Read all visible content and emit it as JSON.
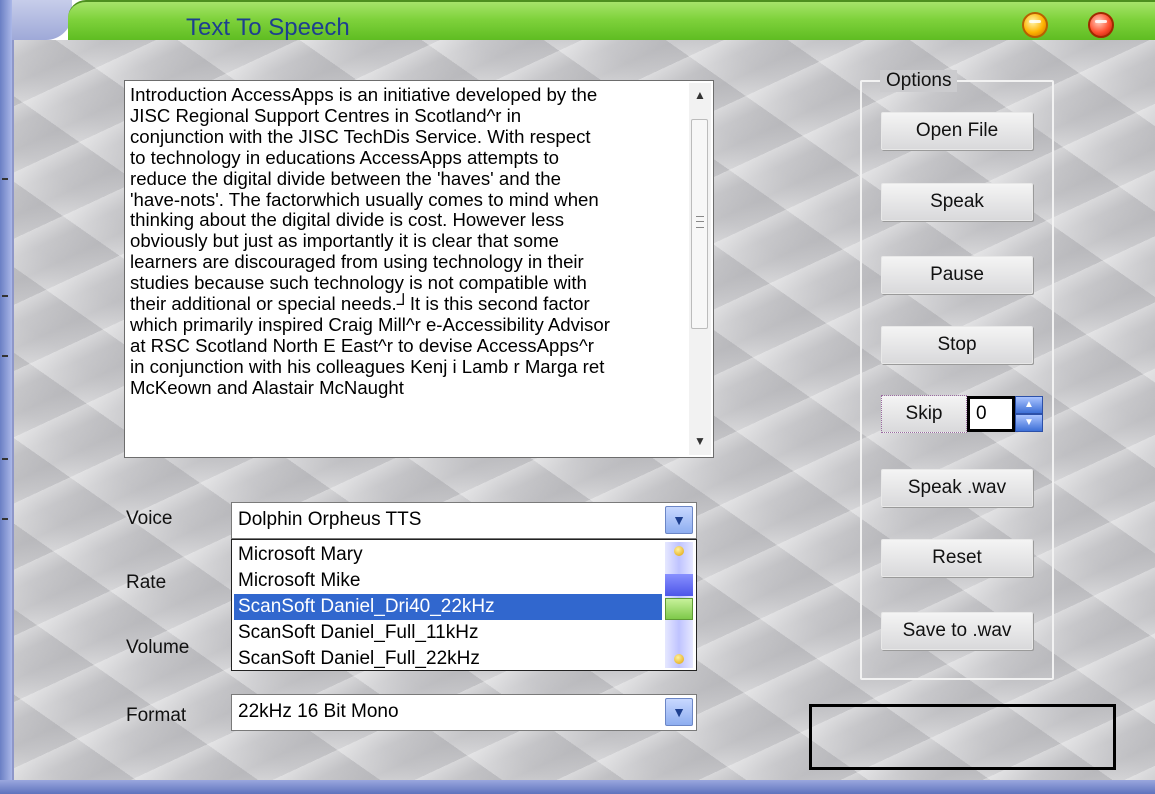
{
  "window": {
    "title": "Text To Speech"
  },
  "text_area": {
    "lines": [
      "Introduction AccessApps is an initiative developed by the",
      "JISC Regional Support Centres in Scotland^r in",
      "conjunction with the JISC TechDis Service. With respect",
      "to technology in educations AccessApps attempts to",
      "reduce the digital divide between the 'haves' and the",
      "'have-nots'. The factorwhich usually comes to mind when",
      "thinking about the digital divide is cost. However less",
      "obviously but just as importantly it is clear that some",
      "learners are discouraged from using technology in their",
      "studies because such technology is not compatible with",
      "their additional or special needs.┘It is this second factor",
      "which primarily inspired Craig Mill^r e-Accessibility Advisor",
      "at RSC Scotland North E East^r to devise AccessApps^r",
      "in conjunction with his colleagues Kenj i Lamb r Marga ret",
      "McKeown and Alastair McNaught"
    ]
  },
  "labels": {
    "voice": "Voice",
    "rate": "Rate",
    "volume": "Volume",
    "format": "Format"
  },
  "voice_combo": {
    "value": "Dolphin Orpheus TTS",
    "options": [
      "Microsoft Mary",
      "Microsoft Mike",
      "ScanSoft Daniel_Dri40_22kHz",
      "ScanSoft Daniel_Full_11kHz",
      "ScanSoft Daniel_Full_22kHz"
    ],
    "selected_index": 2
  },
  "format_combo": {
    "value": "22kHz 16 Bit Mono"
  },
  "options": {
    "legend": "Options",
    "open_file": "Open File",
    "speak": "Speak",
    "pause": "Pause",
    "stop": "Stop",
    "skip": "Skip",
    "skip_value": "0",
    "speak_wav": "Speak .wav",
    "reset": "Reset",
    "save_wav": "Save to .wav"
  },
  "icons": {
    "minimize": "minimize-orb-icon",
    "close": "close-orb-icon",
    "dropdown": "chevron-down-icon",
    "spin_up": "triangle-up-icon",
    "spin_down": "triangle-down-icon"
  },
  "colors": {
    "titlebar": "#7fd23c",
    "title_text": "#1d3f8f",
    "selection": "#3167ce"
  }
}
